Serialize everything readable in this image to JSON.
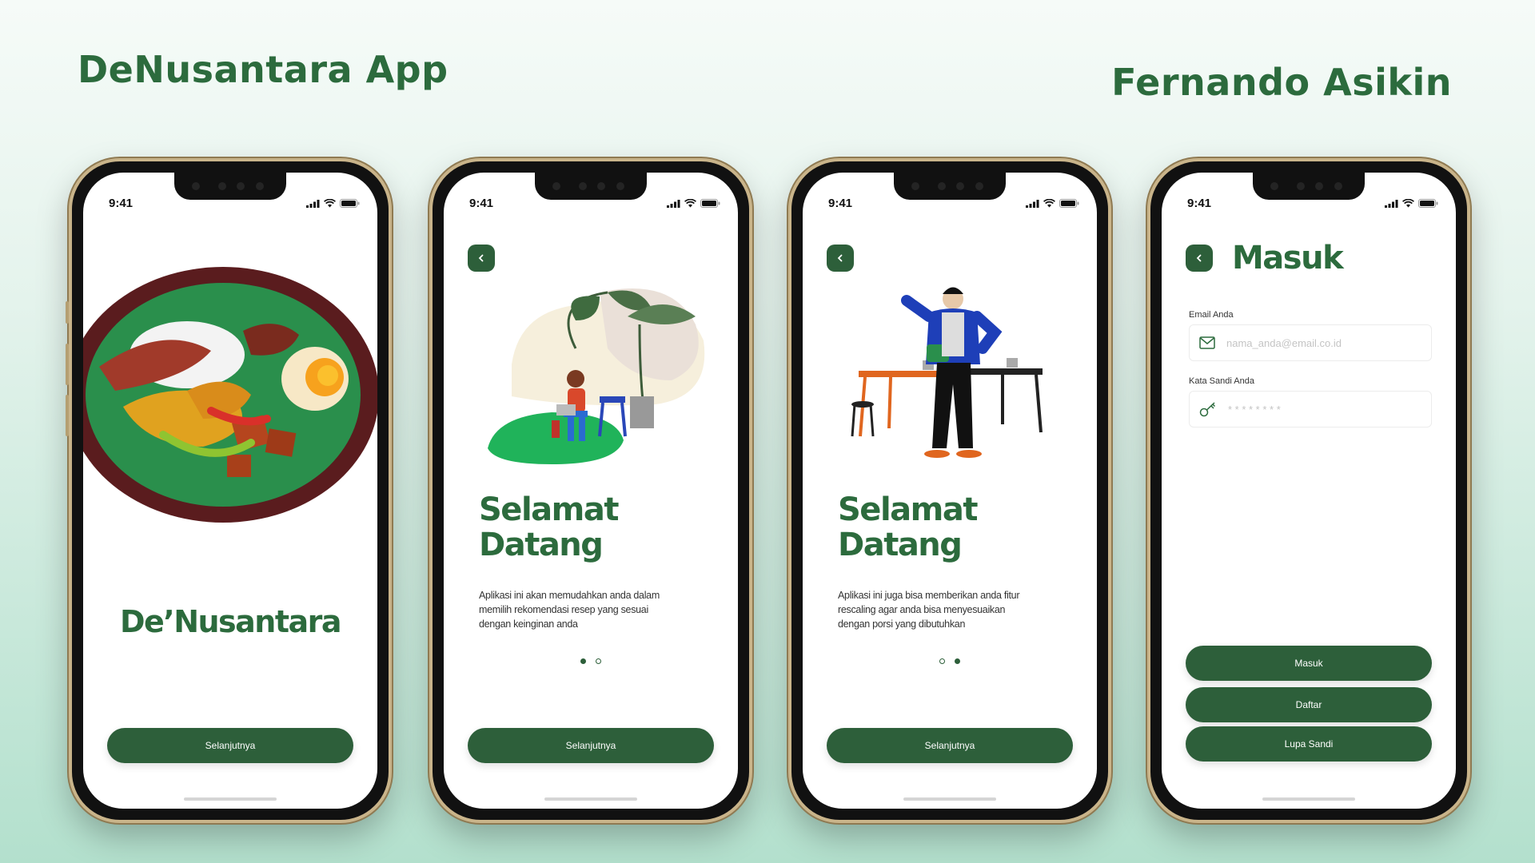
{
  "header": {
    "app_title": "DeNusantara App",
    "author": "Fernando Asikin"
  },
  "status_bar": {
    "time": "9:41"
  },
  "screens": [
    {
      "brand": "De’Nusantara",
      "button": "Selanjutnya"
    },
    {
      "title_line1": "Selamat",
      "title_line2": "Datang",
      "description": "Aplikasi ini akan memudahkan anda dalam memilih rekomendasi resep yang sesuai dengan keinginan anda",
      "active_page": 1,
      "button": "Selanjutnya"
    },
    {
      "title_line1": "Selamat",
      "title_line2": "Datang",
      "description": "Aplikasi ini juga bisa memberikan anda fitur rescaling agar anda bisa menyesuaikan dengan porsi yang dibutuhkan",
      "active_page": 2,
      "button": "Selanjutnya"
    },
    {
      "title": "Masuk",
      "email_label": "Email Anda",
      "email_placeholder": "nama_anda@email.co.id",
      "password_label": "Kata Sandi Anda",
      "password_placeholder": "* * * * * * * *",
      "login_button": "Masuk",
      "register_button": "Daftar",
      "forgot_button": "Lupa Sandi"
    }
  ],
  "colors": {
    "brand_green": "#2c6b3d",
    "button_green": "#2d5f3a"
  },
  "icons": [
    "back-arrow-icon",
    "mail-icon",
    "key-icon",
    "signal-icon",
    "wifi-icon",
    "battery-icon"
  ]
}
